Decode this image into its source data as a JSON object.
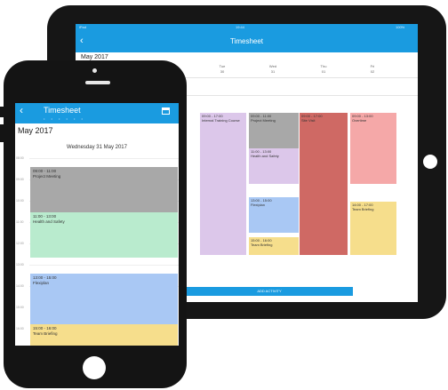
{
  "tablet": {
    "status_left": "iPad",
    "status_center": "19:44",
    "status_right": "100%",
    "header_title": "Timesheet",
    "back_icon": "chevron-left-icon",
    "month": "May 2017",
    "days": [
      {
        "name": "Tue",
        "num": "30"
      },
      {
        "name": "Wed",
        "num": "31"
      },
      {
        "name": "Thu",
        "num": "01"
      },
      {
        "name": "Fri",
        "num": "02"
      }
    ],
    "events": [
      {
        "time": "09:00 - 17:00",
        "title": "Internal Training Course"
      },
      {
        "time": "09:00 - 11:00",
        "title": "Project Meeting"
      },
      {
        "time": "11:00 - 13:00",
        "title": "Health and Safety"
      },
      {
        "time": "09:00 - 17:00",
        "title": "Site Visit"
      },
      {
        "time": "09:00 - 13:00",
        "title": "Overtime"
      },
      {
        "time": "13:00 - 15:00",
        "title": "Flexiplan"
      },
      {
        "time": "15:00 - 16:00",
        "title": "Team Briefing"
      },
      {
        "time": "14:00 - 17:00",
        "title": "Team Briefing"
      }
    ],
    "bottom_bar_label": "ADD ACTIVITY"
  },
  "phone": {
    "header_title": "Timesheet",
    "back_icon": "chevron-left-icon",
    "calendar_icon": "calendar-icon",
    "page_dots": "• • • • • •",
    "month": "May 2017",
    "day_title": "Wednesday  31 May 2017",
    "times": [
      "08:00",
      "09:00",
      "10:00",
      "11:00",
      "12:00",
      "13:00",
      "14:00",
      "15:00",
      "16:00"
    ],
    "events": [
      {
        "time": "09:00 - 11:00",
        "title": "Project Meeting"
      },
      {
        "time": "11:00 - 13:00",
        "title": "Health and Safety"
      },
      {
        "time": "13:00 - 15:00",
        "title": "Flexiplan"
      },
      {
        "time": "15:00 - 16:00",
        "title": "Team Briefing"
      }
    ]
  },
  "colors": {
    "accent": "#1a9be0",
    "event_gray": "#a8a8a8",
    "event_green": "#b9ebce",
    "event_blue": "#a9c8f4",
    "event_yellow": "#f6de8c",
    "event_purple": "#dcc7ea",
    "event_red": "#cf6964",
    "event_pink": "#f5a8a8"
  }
}
